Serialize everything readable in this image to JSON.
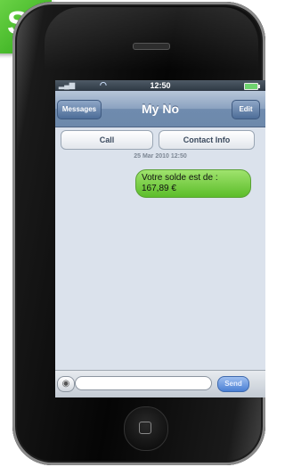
{
  "badge": {
    "letter": "S",
    "color": "#3cb91f"
  },
  "status_bar": {
    "time": "12:50",
    "signal": "▂▄▆",
    "wifi": "◠"
  },
  "nav": {
    "back_label": "Messages",
    "title": "My No",
    "edit_label": "Edit"
  },
  "actions": {
    "call_label": "Call",
    "contact_label": "Contact Info"
  },
  "thread": {
    "date": "25 Mar 2010 12:50",
    "messages": [
      {
        "line1": "Votre solde est de :",
        "line2": "167,89 €"
      }
    ]
  },
  "composer": {
    "placeholder": "",
    "send_label": "Send",
    "camera_icon": "camera-icon"
  }
}
